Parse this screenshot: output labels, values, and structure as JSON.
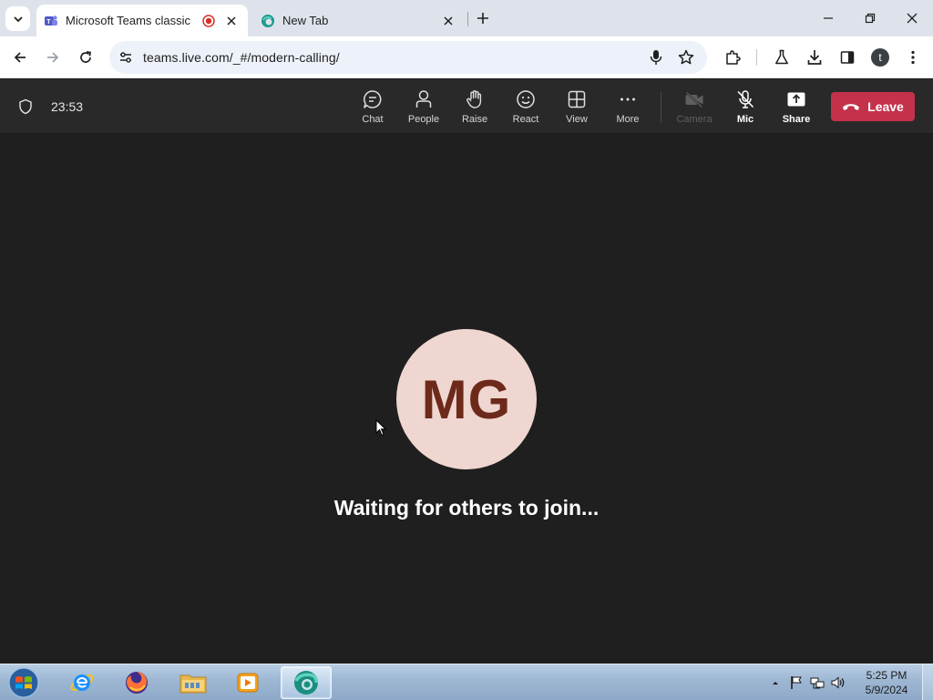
{
  "browser": {
    "tabs": [
      {
        "title": "Microsoft Teams classic",
        "active": true,
        "recording": true
      },
      {
        "title": "New Tab",
        "active": false
      }
    ],
    "url": "teams.live.com/_#/modern-calling/",
    "profile_initial": "t"
  },
  "call": {
    "timer": "23:53",
    "controls": [
      {
        "label": "Chat",
        "icon": "chat-icon"
      },
      {
        "label": "People",
        "icon": "people-icon"
      },
      {
        "label": "Raise",
        "icon": "raise-hand-icon"
      },
      {
        "label": "React",
        "icon": "smiley-icon"
      },
      {
        "label": "View",
        "icon": "grid-view-icon"
      },
      {
        "label": "More",
        "icon": "more-icon"
      },
      {
        "label": "Camera",
        "icon": "camera-off-icon",
        "disabled": true
      },
      {
        "label": "Mic",
        "icon": "mic-off-icon"
      },
      {
        "label": "Share",
        "icon": "share-icon"
      }
    ],
    "leave_label": "Leave",
    "leave_color": "#c4314b"
  },
  "stage": {
    "avatar_initials": "MG",
    "avatar_bg": "#efd6d0",
    "status_text": "Waiting for others to join..."
  },
  "taskbar": {
    "apps": [
      "internet-explorer-icon",
      "firefox-icon",
      "file-explorer-icon",
      "media-player-icon",
      "edge-browser-icon"
    ],
    "time": "5:25 PM",
    "date": "5/9/2024"
  }
}
